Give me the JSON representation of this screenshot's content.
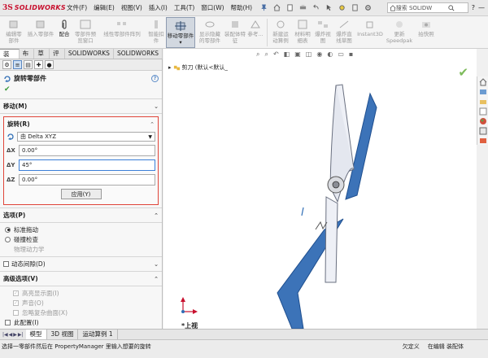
{
  "app": {
    "logo_ds": "3S",
    "logo_text": "SOLIDWORKS"
  },
  "menu": [
    "文件(F)",
    "编辑(E)",
    "视图(V)",
    "插入(I)",
    "工具(T)",
    "窗口(W)",
    "帮助(H)"
  ],
  "search": {
    "value": "搜索 SOLIDW"
  },
  "ribbon": {
    "buttons": [
      {
        "label1": "编辑零",
        "label2": "部件"
      },
      {
        "label1": "插入零部件",
        "label2": ""
      },
      {
        "label1": "配合",
        "label2": ""
      },
      {
        "label1": "零部件预",
        "label2": "览窗口"
      },
      {
        "label1": "线性零部件阵列",
        "label2": ""
      },
      {
        "label1": "智能扣",
        "label2": "件"
      },
      {
        "label1": "移动零部件",
        "label2": ""
      },
      {
        "label1": "显示隐藏",
        "label2": "的零部件"
      },
      {
        "label1": "装配体特",
        "label2": "征"
      },
      {
        "label1": "参考...",
        "label2": ""
      },
      {
        "label1": "新建运",
        "label2": "动算例"
      },
      {
        "label1": "材料明",
        "label2": "细表"
      },
      {
        "label1": "爆炸视",
        "label2": "图"
      },
      {
        "label1": "爆炸直",
        "label2": "线草图"
      },
      {
        "label1": "Instant3D",
        "label2": ""
      },
      {
        "label1": "更新",
        "label2": "Speedpak"
      },
      {
        "label1": "拍快照",
        "label2": ""
      }
    ]
  },
  "tabs": [
    "装配体",
    "布局",
    "草图",
    "评估",
    "SOLIDWORKS 插件",
    "SOLIDWORKS MBD"
  ],
  "property_manager": {
    "title": "旋转零部件",
    "move_group": "移动(M)",
    "rotate_group": "旋转(R)",
    "rotate_mode": "由 Delta XYZ",
    "dx_label": "ΔX",
    "dy_label": "ΔY",
    "dz_label": "ΔZ",
    "dx": "0.00°",
    "dy": "45°",
    "dz": "0.00°",
    "apply": "应用(Y)",
    "options_group": "选项(P)",
    "options": [
      "标准拖动",
      "碰撞检查",
      "物理动力学"
    ],
    "dynamic_clearance": "动态间隙(D)",
    "advanced_group": "高级选项(V)",
    "advanced": [
      "高亮显示面(I)",
      "声音(O)",
      "忽略复杂曲面(X)",
      "此配置(I)"
    ]
  },
  "graphics": {
    "tree_node": "剪刀 (默认<默认_",
    "view_label": "*上视"
  },
  "bottom_tabs": [
    "模型",
    "3D 视图",
    "运动算例 1"
  ],
  "status": {
    "message": "选择一零部件然后在 PropertyManager 里输入想要的旋转",
    "items": [
      "欠定义",
      "在编辑 装配体"
    ]
  },
  "colors": {
    "blade": "#3c73b8",
    "accent_red": "#e0453a",
    "ok_green": "#3a9a3a"
  }
}
